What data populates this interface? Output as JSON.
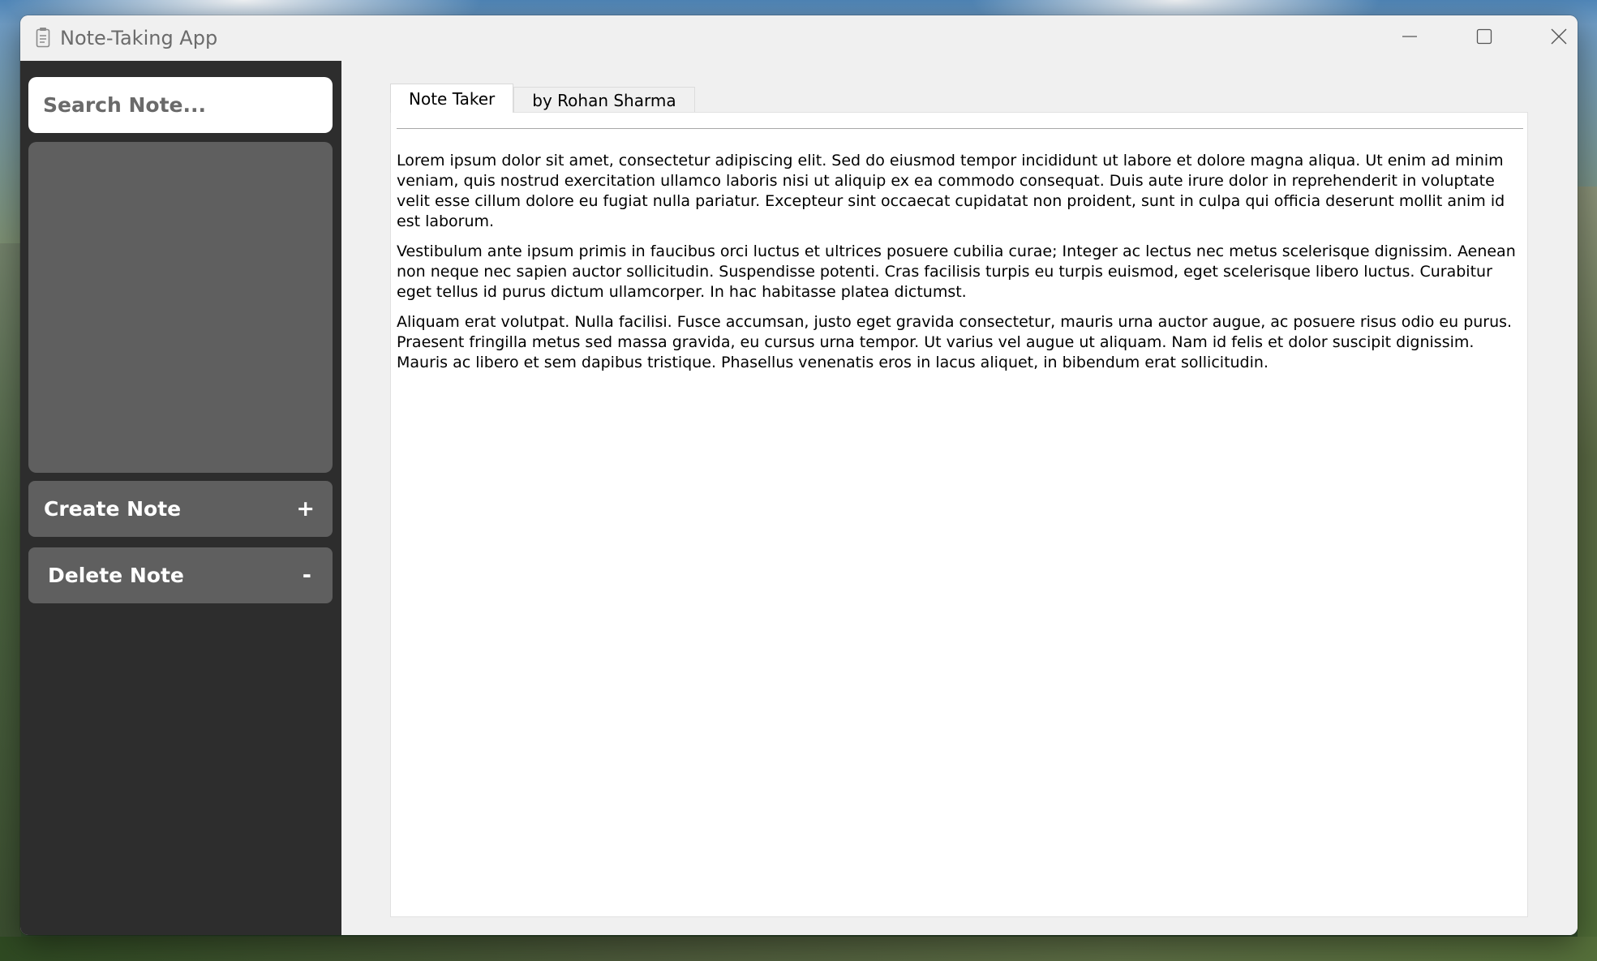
{
  "window": {
    "title": "Note-Taking App",
    "controls": {
      "minimize": "minimize",
      "maximize": "maximize",
      "close": "close"
    }
  },
  "sidebar": {
    "search": {
      "placeholder": "Search Note...",
      "value": ""
    },
    "notes": [],
    "create_button": {
      "label": "Create Note",
      "symbol": "+"
    },
    "delete_button": {
      "label": "Delete Note",
      "symbol": "-"
    }
  },
  "main": {
    "tabs": [
      {
        "label": "Note Taker",
        "active": true
      },
      {
        "label": "by Rohan Sharma",
        "active": false
      }
    ],
    "paragraphs": [
      "Lorem ipsum dolor sit amet, consectetur adipiscing elit. Sed do eiusmod tempor incididunt ut labore et dolore magna aliqua. Ut enim ad minim veniam, quis nostrud exercitation ullamco laboris nisi ut aliquip ex ea commodo consequat. Duis aute irure dolor in reprehenderit in voluptate velit esse cillum dolore eu fugiat nulla pariatur. Excepteur sint occaecat cupidatat non proident, sunt in culpa qui officia deserunt mollit anim id est laborum.",
      "Vestibulum ante ipsum primis in faucibus orci luctus et ultrices posuere cubilia curae; Integer ac lectus nec metus scelerisque dignissim. Aenean non neque nec sapien auctor sollicitudin. Suspendisse potenti. Cras facilisis turpis eu turpis euismod, eget scelerisque libero luctus. Curabitur eget tellus id purus dictum ullamcorper. In hac habitasse platea dictumst.",
      "Aliquam erat volutpat. Nulla facilisi. Fusce accumsan, justo eget gravida consectetur, mauris urna auctor augue, ac posuere risus odio eu purus. Praesent fringilla metus sed massa gravida, eu cursus urna tempor. Ut varius vel augue ut aliquam. Nam id felis et dolor suscipit dignissim. Mauris ac libero et sem dapibus tristique. Phasellus venenatis eros in lacus aliquet, in bibendum erat sollicitudin."
    ]
  },
  "icons": {
    "app": "notepad-icon",
    "minimize": "minimize-icon",
    "maximize": "maximize-icon",
    "close": "close-icon"
  },
  "colors": {
    "sidebar_bg": "#2d2d2d",
    "sidebar_button_bg": "#5f5f5f",
    "note_list_bg": "#5f5f5f",
    "window_bg": "#f0f0f0",
    "content_bg": "#ffffff"
  }
}
